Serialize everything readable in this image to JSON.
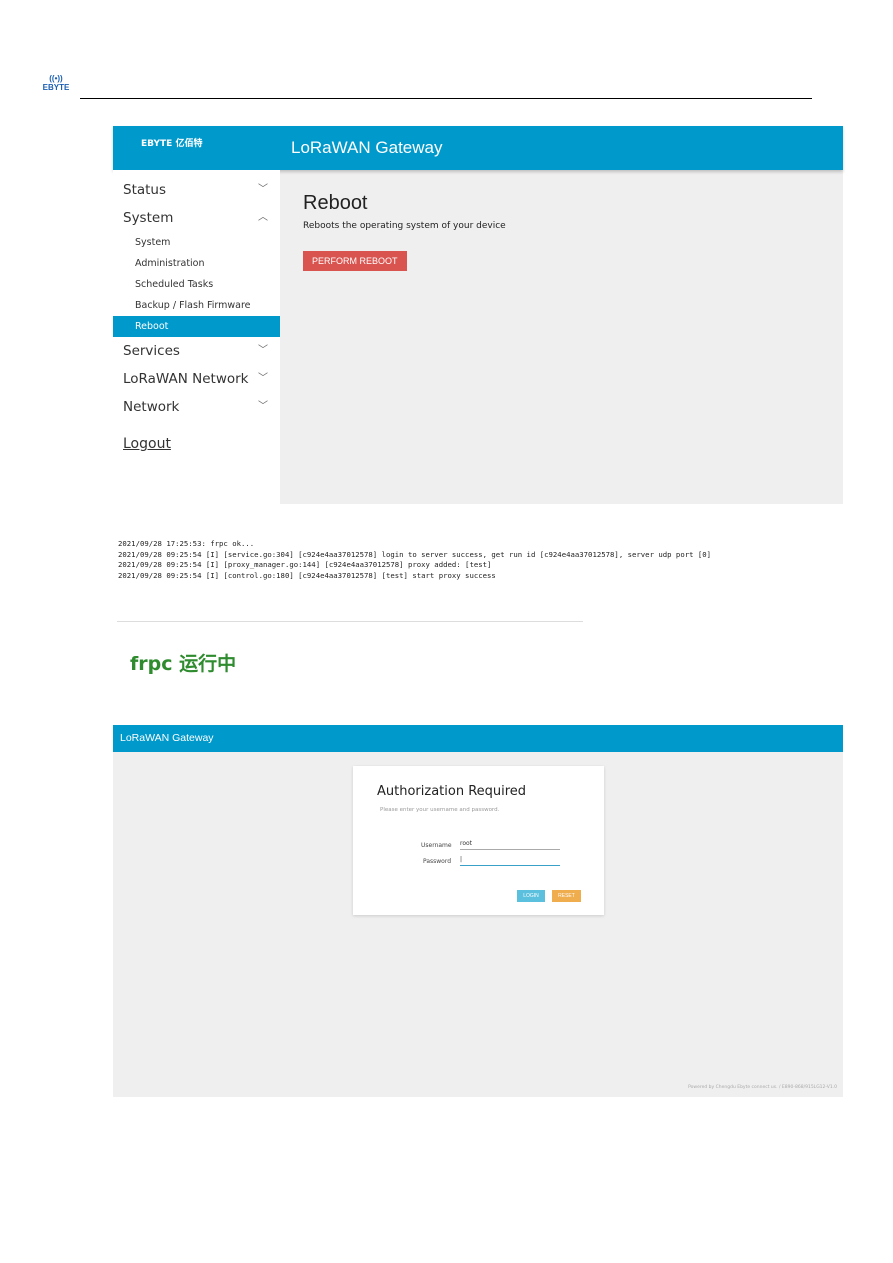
{
  "doc": {
    "logo": "EBYTE"
  },
  "shot1": {
    "brand": "EBYTE 亿佰特",
    "title": "LoRaWAN Gateway",
    "menu": [
      {
        "label": "Status",
        "chevron": "chevron-down-icon"
      },
      {
        "label": "System",
        "chevron": "chevron-up-icon",
        "sub": [
          "System",
          "Administration",
          "Scheduled Tasks",
          "Backup / Flash Firmware",
          "Reboot"
        ]
      },
      {
        "label": "Services",
        "chevron": "chevron-down-icon"
      },
      {
        "label": "LoRaWAN Network",
        "chevron": "chevron-down-icon"
      },
      {
        "label": "Network",
        "chevron": "chevron-down-icon"
      }
    ],
    "active_sub": "Reboot",
    "logout": "Logout",
    "page_title": "Reboot",
    "page_desc": "Reboots the operating system of your device",
    "reboot_button": "PERFORM REBOOT",
    "accent": "#0099cc",
    "danger": "#d9534f"
  },
  "log": {
    "lines": [
      "2021/09/28 17:25:53: frpc ok...",
      "2021/09/28 09:25:54 [I] [service.go:304] [c924e4aa37012578] login to server success, get run id [c924e4aa37012578], server udp port [0]",
      "2021/09/28 09:25:54 [I] [proxy_manager.go:144] [c924e4aa37012578] proxy added: [test]",
      "2021/09/28 09:25:54 [I] [control.go:180] [c924e4aa37012578] [test] start proxy success"
    ]
  },
  "frpc_status": "frpc 运行中",
  "shot3": {
    "title": "LoRaWAN Gateway",
    "dialog_title": "Authorization Required",
    "hint": "Please enter your username and password.",
    "username_label": "Username",
    "username_value": "root",
    "password_label": "Password",
    "password_value": "|",
    "login": "LOGIN",
    "reset": "RESET",
    "footer": "Powered by Chengdu Ebyte connect us. / E890-868/915LG12-V1.0"
  }
}
